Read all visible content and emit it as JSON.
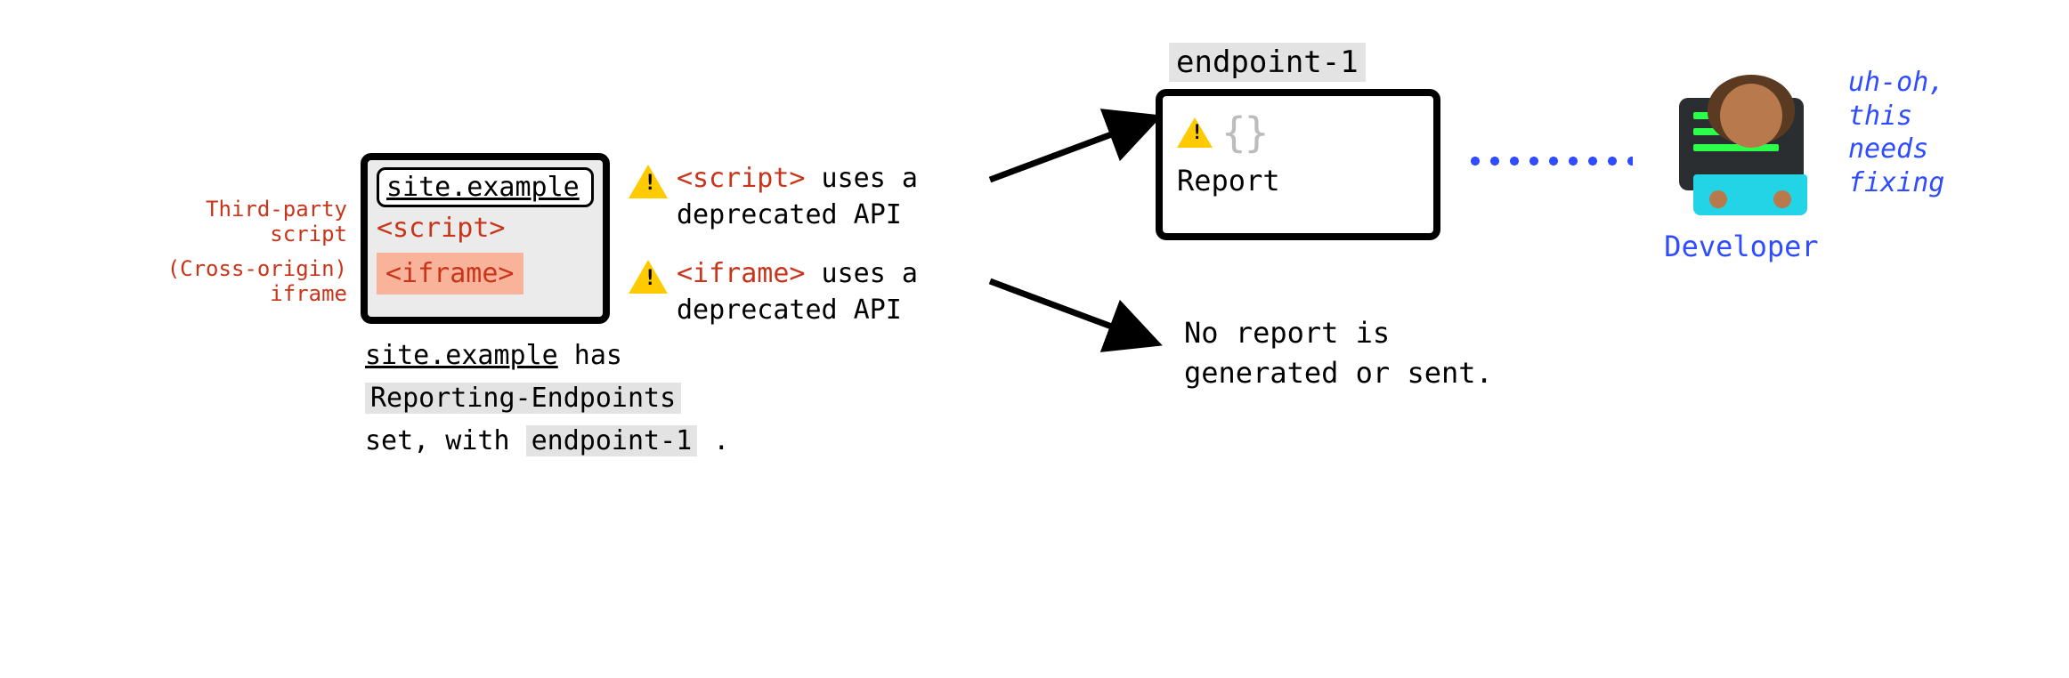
{
  "site": {
    "url": "site.example",
    "tags": {
      "script": "<script>",
      "iframe": "<iframe>"
    },
    "labels": {
      "third_party": "Third-party\nscript",
      "cross_origin": "(Cross-origin)\niframe"
    }
  },
  "caption": {
    "parts": {
      "p1": "site.example",
      "p2": " has ",
      "p3": "Reporting-Endpoints",
      "p4": "set, with ",
      "p5": "endpoint-1",
      "p6": " ."
    }
  },
  "messages": {
    "script": {
      "code": "<script>",
      "rest": " uses a deprecated API"
    },
    "iframe": {
      "code": "<iframe>",
      "rest": " uses a deprecated API"
    }
  },
  "endpoint": {
    "name": "endpoint-1",
    "braces": "{}",
    "report_label": "Report"
  },
  "no_report": "No report is\ngenerated or sent.",
  "developer": {
    "label": "Developer",
    "thought": "uh-oh,\nthis\nneeds\nfixing"
  },
  "icons": {
    "warning": "warning-icon"
  }
}
